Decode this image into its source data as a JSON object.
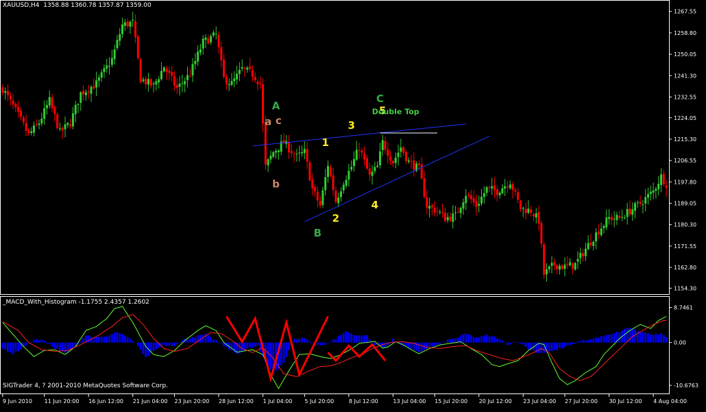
{
  "price_header": "XAUUSD,H4  1358.88 1360.78 1357.87 1359.00",
  "macd_header": "_MACD_With_Histogram -1.1755 2.4357 1.2602",
  "copyright": "SIGTrader 4, ? 2001-2010 MetaQuotes Software Corp.",
  "colors": {
    "background": "#000000",
    "frame": "#ffffff",
    "bull_candle": "#33cc33",
    "bear_candle": "#ff0000",
    "trendline": "#2233ff",
    "double_top_line": "#ffffff",
    "histogram": "#0000ff",
    "macd_line": "#66ff33",
    "signal_line": "#ff2222",
    "zigzag": "#ff0000",
    "wave_green": "#33aa44",
    "wave_brown": "#cc8866",
    "wave_yellow": "#ffee22",
    "double_top_label": "#44cc44"
  },
  "annotations": [
    {
      "text": "A",
      "style": "green",
      "time_index": 105,
      "price": 1227.5
    },
    {
      "text": "a",
      "style": "brown",
      "time_index": 102,
      "price": 1221.0
    },
    {
      "text": "c",
      "style": "brown",
      "time_index": 106,
      "price": 1221.5
    },
    {
      "text": "b",
      "style": "brown",
      "time_index": 105,
      "price": 1195.5
    },
    {
      "text": "B",
      "style": "green",
      "time_index": 121,
      "price": 1175.5
    },
    {
      "text": "1",
      "style": "yellow",
      "time_index": 124,
      "price": 1212.5
    },
    {
      "text": "2",
      "style": "yellow",
      "time_index": 128,
      "price": 1181.5
    },
    {
      "text": "3",
      "style": "yellow",
      "time_index": 134,
      "price": 1219.5
    },
    {
      "text": "4",
      "style": "yellow",
      "time_index": 143,
      "price": 1187.0
    },
    {
      "text": "C",
      "style": "green",
      "time_index": 145,
      "price": 1230.5
    },
    {
      "text": "5",
      "style": "yellow",
      "time_index": 146,
      "price": 1225.5
    },
    {
      "text": "Double Top",
      "style": "dtop",
      "time_index": 151,
      "price": 1225.5
    }
  ],
  "chart_data": [
    {
      "type": "candlestick",
      "symbol": "XAUUSD",
      "timeframe": "H4",
      "last_bar": {
        "open": 1358.88,
        "high": 1360.78,
        "low": 1357.87,
        "close": 1359.0
      },
      "y_ticks": [
        1267.55,
        1258.8,
        1250.05,
        1241.3,
        1232.55,
        1224.05,
        1215.3,
        1206.55,
        1197.8,
        1189.05,
        1180.3,
        1171.55,
        1162.8,
        1154.3
      ],
      "ylim": [
        1153.0,
        1270.0
      ],
      "x_ticks": [
        {
          "label": "9 Jun 2010",
          "i": 0
        },
        {
          "label": "11 Jun 20:00",
          "i": 16
        },
        {
          "label": "16 Jun 12:00",
          "i": 33
        },
        {
          "label": "21 Jun 04:00",
          "i": 50
        },
        {
          "label": "23 Jun 20:00",
          "i": 66
        },
        {
          "label": "28 Jun 12:00",
          "i": 83
        },
        {
          "label": "1 Jul 04:00",
          "i": 100
        },
        {
          "label": "5 Jul 20:00",
          "i": 116
        },
        {
          "label": "8 Jul 12:00",
          "i": 133
        },
        {
          "label": "13 Jul 04:00",
          "i": 150
        },
        {
          "label": "15 Jul 20:00",
          "i": 166
        },
        {
          "label": "20 Jul 12:00",
          "i": 183
        },
        {
          "label": "23 Jul 04:00",
          "i": 200
        },
        {
          "label": "27 Jul 20:00",
          "i": 216
        },
        {
          "label": "30 Jul 12:00",
          "i": 233
        },
        {
          "label": "4 Aug 04:00",
          "i": 250
        }
      ],
      "bar_count": 256,
      "close_path": [
        [
          0,
          1236
        ],
        [
          6,
          1225
        ],
        [
          10,
          1217
        ],
        [
          14,
          1222
        ],
        [
          18,
          1231
        ],
        [
          22,
          1218
        ],
        [
          26,
          1222
        ],
        [
          30,
          1234
        ],
        [
          36,
          1238
        ],
        [
          42,
          1248
        ],
        [
          46,
          1262
        ],
        [
          50,
          1263
        ],
        [
          53,
          1240
        ],
        [
          58,
          1237
        ],
        [
          62,
          1245
        ],
        [
          67,
          1236
        ],
        [
          72,
          1242
        ],
        [
          77,
          1255
        ],
        [
          82,
          1258
        ],
        [
          85,
          1240
        ],
        [
          88,
          1238
        ],
        [
          92,
          1244
        ],
        [
          96,
          1242
        ],
        [
          99,
          1238
        ],
        [
          101,
          1204
        ],
        [
          104,
          1210
        ],
        [
          108,
          1214
        ],
        [
          113,
          1208
        ],
        [
          116,
          1210
        ],
        [
          119,
          1195
        ],
        [
          122,
          1188
        ],
        [
          125,
          1205
        ],
        [
          128,
          1190
        ],
        [
          131,
          1198
        ],
        [
          134,
          1204
        ],
        [
          137,
          1212
        ],
        [
          141,
          1200
        ],
        [
          144,
          1204
        ],
        [
          146,
          1214
        ],
        [
          150,
          1206
        ],
        [
          153,
          1212
        ],
        [
          156,
          1206
        ],
        [
          160,
          1203
        ],
        [
          163,
          1188
        ],
        [
          167,
          1186
        ],
        [
          170,
          1183
        ],
        [
          174,
          1184
        ],
        [
          178,
          1193
        ],
        [
          182,
          1188
        ],
        [
          186,
          1195
        ],
        [
          190,
          1194
        ],
        [
          195,
          1198
        ],
        [
          199,
          1187
        ],
        [
          203,
          1186
        ],
        [
          206,
          1182
        ],
        [
          208,
          1160
        ],
        [
          212,
          1164
        ],
        [
          216,
          1163
        ],
        [
          220,
          1164
        ],
        [
          225,
          1172
        ],
        [
          229,
          1178
        ],
        [
          233,
          1183
        ],
        [
          237,
          1183
        ],
        [
          241,
          1186
        ],
        [
          245,
          1189
        ],
        [
          250,
          1194
        ],
        [
          253,
          1200
        ],
        [
          255,
          1197
        ]
      ],
      "trendlines": [
        {
          "name": "upper-trendline",
          "from": {
            "i": 96,
            "price": 1212.5
          },
          "to": {
            "i": 178,
            "price": 1221.5
          }
        },
        {
          "name": "lower-trendline",
          "from": {
            "i": 116,
            "price": 1181.5
          },
          "to": {
            "i": 187,
            "price": 1216.5
          }
        },
        {
          "name": "double-top-line",
          "from": {
            "i": 145,
            "price": 1217.8
          },
          "to": {
            "i": 167,
            "price": 1217.8
          }
        }
      ]
    },
    {
      "type": "macd",
      "name": "_MACD_With_Histogram",
      "values": {
        "histogram": -1.1755,
        "macd": 2.4357,
        "signal": 1.2602
      },
      "y_ticks": [
        8.7461,
        0.0,
        -10.6763
      ],
      "ylim": [
        -12.2,
        10.2
      ],
      "histogram_path": [
        [
          0,
          -1.5
        ],
        [
          4,
          -2.8
        ],
        [
          8,
          -1.2
        ],
        [
          12,
          0.8
        ],
        [
          16,
          0.5
        ],
        [
          20,
          -1.5
        ],
        [
          24,
          -2.6
        ],
        [
          28,
          -1.0
        ],
        [
          32,
          1.8
        ],
        [
          36,
          1.2
        ],
        [
          40,
          1.5
        ],
        [
          44,
          2.6
        ],
        [
          48,
          1.3
        ],
        [
          52,
          -0.8
        ],
        [
          55,
          -3.8
        ],
        [
          58,
          -2.0
        ],
        [
          62,
          -0.6
        ],
        [
          66,
          -0.7
        ],
        [
          70,
          0.8
        ],
        [
          74,
          1.5
        ],
        [
          78,
          2.0
        ],
        [
          82,
          0.5
        ],
        [
          86,
          -1.3
        ],
        [
          90,
          -2.8
        ],
        [
          94,
          -1.6
        ],
        [
          98,
          -0.8
        ],
        [
          101,
          -5.0
        ],
        [
          104,
          -7.6
        ],
        [
          108,
          -5.0
        ],
        [
          112,
          0.8
        ],
        [
          116,
          1.2
        ],
        [
          120,
          -0.5
        ],
        [
          124,
          -0.6
        ],
        [
          128,
          1.0
        ],
        [
          132,
          2.8
        ],
        [
          134,
          2.2
        ],
        [
          137,
          1.6
        ],
        [
          140,
          1.8
        ],
        [
          143,
          -0.6
        ],
        [
          147,
          -1.2
        ],
        [
          150,
          0.8
        ],
        [
          154,
          -0.9
        ],
        [
          157,
          -1.8
        ],
        [
          160,
          -2.4
        ],
        [
          164,
          -1.2
        ],
        [
          168,
          -0.5
        ],
        [
          171,
          0.6
        ],
        [
          175,
          1.3
        ],
        [
          178,
          2.2
        ],
        [
          182,
          1.2
        ],
        [
          186,
          1.8
        ],
        [
          190,
          1.2
        ],
        [
          194,
          -0.5
        ],
        [
          198,
          0.3
        ],
        [
          202,
          -1.6
        ],
        [
          206,
          -2.6
        ],
        [
          209,
          -2.4
        ],
        [
          212,
          -2.0
        ],
        [
          215,
          -1.4
        ],
        [
          219,
          -0.5
        ],
        [
          222,
          0.4
        ],
        [
          226,
          0.8
        ],
        [
          230,
          1.5
        ],
        [
          234,
          2.0
        ],
        [
          238,
          3.0
        ],
        [
          241,
          3.8
        ],
        [
          244,
          2.8
        ],
        [
          247,
          2.4
        ],
        [
          250,
          1.8
        ],
        [
          253,
          2.2
        ],
        [
          255,
          1.2
        ]
      ],
      "macd_path": [
        [
          0,
          5
        ],
        [
          4,
          2
        ],
        [
          8,
          -1
        ],
        [
          12,
          -3.5
        ],
        [
          16,
          -2
        ],
        [
          20,
          -1.8
        ],
        [
          24,
          -3
        ],
        [
          28,
          -1
        ],
        [
          32,
          3
        ],
        [
          36,
          4
        ],
        [
          40,
          6
        ],
        [
          43,
          8.5
        ],
        [
          46,
          9
        ],
        [
          50,
          5
        ],
        [
          55,
          -1
        ],
        [
          58,
          -3
        ],
        [
          62,
          -3.5
        ],
        [
          66,
          -2
        ],
        [
          70,
          0.5
        ],
        [
          75,
          3
        ],
        [
          78,
          4.2
        ],
        [
          82,
          3
        ],
        [
          85,
          0
        ],
        [
          90,
          -2.4
        ],
        [
          96,
          -1.8
        ],
        [
          100,
          -3
        ],
        [
          103,
          -8
        ],
        [
          106,
          -11.5
        ],
        [
          110,
          -7
        ],
        [
          114,
          -3
        ],
        [
          118,
          -2.8
        ],
        [
          122,
          -3.5
        ],
        [
          126,
          -4
        ],
        [
          130,
          -3
        ],
        [
          134,
          -1.6
        ],
        [
          137,
          -0.2
        ],
        [
          141,
          0.1
        ],
        [
          143,
          0.3
        ],
        [
          146,
          -1.4
        ],
        [
          148,
          -1.1
        ],
        [
          151,
          0.2
        ],
        [
          154,
          -0.6
        ],
        [
          157,
          -1.8
        ],
        [
          160,
          -2.8
        ],
        [
          164,
          -1.5
        ],
        [
          168,
          -0.6
        ],
        [
          172,
          -0.2
        ],
        [
          176,
          0.2
        ],
        [
          180,
          -1.5
        ],
        [
          184,
          -3
        ],
        [
          188,
          -5.5
        ],
        [
          191,
          -6
        ],
        [
          194,
          -5.3
        ],
        [
          198,
          -4.5
        ],
        [
          202,
          -2
        ],
        [
          206,
          -0.2
        ],
        [
          208,
          -0.5
        ],
        [
          211,
          -5
        ],
        [
          214,
          -9
        ],
        [
          217,
          -10.5
        ],
        [
          220,
          -9.5
        ],
        [
          224,
          -7.5
        ],
        [
          228,
          -6
        ],
        [
          231,
          -3
        ],
        [
          234,
          -1
        ],
        [
          237,
          1
        ],
        [
          241,
          3
        ],
        [
          245,
          4.5
        ],
        [
          249,
          3.5
        ],
        [
          252,
          5.5
        ],
        [
          255,
          6.5
        ]
      ],
      "signal_path": [
        [
          0,
          5.2
        ],
        [
          6,
          3
        ],
        [
          10,
          0
        ],
        [
          15,
          -1.8
        ],
        [
          20,
          -2.2
        ],
        [
          25,
          -2
        ],
        [
          30,
          -0.5
        ],
        [
          36,
          1.5
        ],
        [
          42,
          4
        ],
        [
          46,
          6.2
        ],
        [
          50,
          7
        ],
        [
          54,
          4.5
        ],
        [
          58,
          1
        ],
        [
          62,
          -1.5
        ],
        [
          66,
          -2.2
        ],
        [
          71,
          -1.5
        ],
        [
          76,
          0.8
        ],
        [
          80,
          2.5
        ],
        [
          84,
          2.2
        ],
        [
          88,
          0.6
        ],
        [
          92,
          -1.5
        ],
        [
          96,
          -2.5
        ],
        [
          100,
          -1.2
        ],
        [
          104,
          -4
        ],
        [
          108,
          -7.8
        ],
        [
          113,
          -8.5
        ],
        [
          118,
          -7
        ],
        [
          122,
          -6
        ],
        [
          126,
          -5.8
        ],
        [
          130,
          -5
        ],
        [
          134,
          -3.8
        ],
        [
          138,
          -3
        ],
        [
          142,
          -1.5
        ],
        [
          146,
          -0.5
        ],
        [
          150,
          0.1
        ],
        [
          154,
          0.2
        ],
        [
          158,
          -0.2
        ],
        [
          163,
          -1.2
        ],
        [
          168,
          -1.5
        ],
        [
          173,
          -1
        ],
        [
          178,
          -0.8
        ],
        [
          182,
          -2
        ],
        [
          187,
          -3
        ],
        [
          192,
          -4
        ],
        [
          196,
          -4.5
        ],
        [
          200,
          -3.6
        ],
        [
          204,
          -2.5
        ],
        [
          207,
          -1.5
        ],
        [
          210,
          -2.5
        ],
        [
          214,
          -6.5
        ],
        [
          218,
          -8.5
        ],
        [
          222,
          -9.5
        ],
        [
          226,
          -8.5
        ],
        [
          230,
          -6
        ],
        [
          234,
          -3.5
        ],
        [
          238,
          -1
        ],
        [
          242,
          1.5
        ],
        [
          246,
          3
        ],
        [
          250,
          4.5
        ],
        [
          254,
          5.5
        ]
      ],
      "zigzags": [
        {
          "name": "zigzag-left",
          "points": [
            [
              86,
              6.5
            ],
            [
              92,
              0.2
            ],
            [
              97,
              6
            ],
            [
              103,
              -9
            ],
            [
              109,
              5
            ],
            [
              114,
              -8
            ],
            [
              125,
              6.5
            ]
          ]
        },
        {
          "name": "zigzag-right",
          "points": [
            [
              125,
              -2.5
            ],
            [
              128,
              -4.5
            ],
            [
              133,
              -0.8
            ],
            [
              137,
              -3.5
            ],
            [
              142,
              -0.5
            ],
            [
              147,
              -4.5
            ]
          ]
        }
      ]
    }
  ]
}
